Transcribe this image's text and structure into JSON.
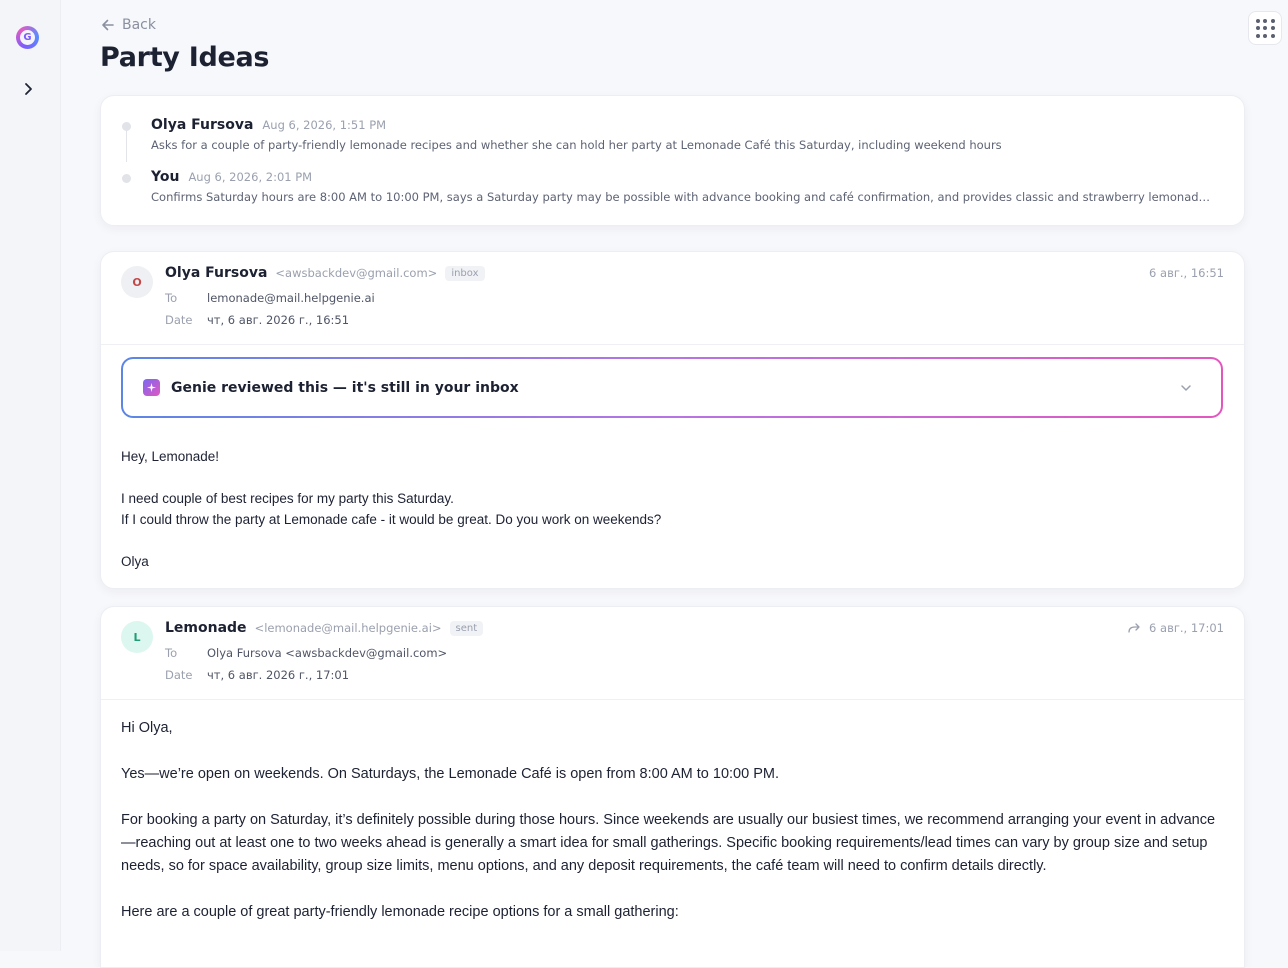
{
  "app": {
    "logo_letter": "G",
    "accent_gradient": [
      "#5b86e6",
      "#b774e4",
      "#e456bf"
    ]
  },
  "nav": {
    "back_label": "Back"
  },
  "thread": {
    "title": "Party Ideas"
  },
  "summary": {
    "entries": [
      {
        "name": "Olya Fursova",
        "date": "Aug 6, 2026, 1:51 PM",
        "text": "Asks for a couple of party-friendly lemonade recipes and whether she can hold her party at Lemonade Café this Saturday, including weekend hours"
      },
      {
        "name": "You",
        "date": "Aug 6, 2026, 2:01 PM",
        "text": "Confirms Saturday hours are 8:00 AM to 10:00 PM, says a Saturday party may be possible with advance booking and café confirmation, and provides classic and strawberry lemonade recipes"
      }
    ]
  },
  "messages": [
    {
      "avatar_letter": "O",
      "from_name": "Olya Fursova",
      "from_email": "<awsbackdev@gmail.com>",
      "tag": "inbox",
      "time": "6 авг., 16:51",
      "to_label": "To",
      "to_value": "lemonade@mail.helpgenie.ai",
      "date_label": "Date",
      "date_value": "чт, 6 авг. 2026 г., 16:51",
      "genie_banner": "Genie reviewed this — it's still in your inbox",
      "body": {
        "greeting": "Hey, Lemonade!",
        "line1": "I need couple of best recipes for my party this Saturday.",
        "line2": "If I could throw the party at Lemonade cafe - it would be great. Do you work on weekends?",
        "signoff": "Olya"
      }
    },
    {
      "avatar_letter": "L",
      "from_name": "Lemonade",
      "from_email": "<lemonade@mail.helpgenie.ai>",
      "tag": "sent",
      "time": "6 авг., 17:01",
      "to_label": "To",
      "to_value": "Olya Fursova <awsbackdev@gmail.com>",
      "date_label": "Date",
      "date_value": "чт, 6 авг. 2026 г., 17:01",
      "body": {
        "greeting": "Hi Olya,",
        "para1": "Yes—we’re open on weekends. On Saturdays, the Lemonade Café is open from 8:00 AM to 10:00 PM.",
        "para2": "For booking a party on Saturday, it’s definitely possible during those hours. Since weekends are usually our busiest times, we recommend arranging your event in advance—reaching out at least one to two weeks ahead is generally a smart idea for small gatherings. Specific booking requirements/lead times can vary by group size and setup needs, so for space availability, group size limits, menu options, and any deposit requirements, the café team will need to confirm details directly.",
        "para3": "Here are a couple of great party-friendly lemonade recipe options for a small gathering:"
      }
    }
  ]
}
